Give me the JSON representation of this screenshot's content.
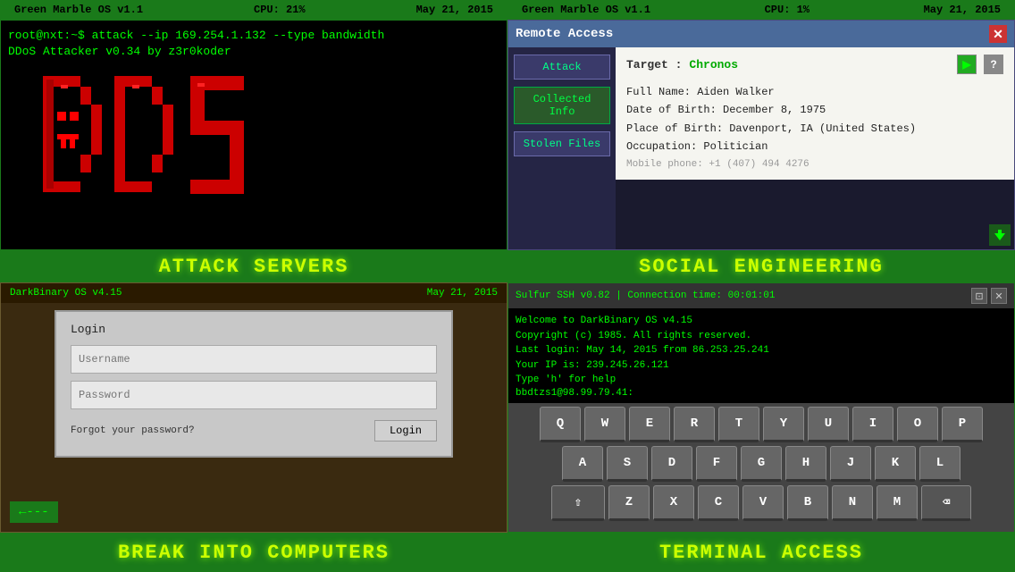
{
  "top_status_bar_left": {
    "os": "Green Marble OS v1.1",
    "cpu": "CPU: 21%",
    "date": "May 21, 2015"
  },
  "top_status_bar_right": {
    "os": "Green Marble OS v1.1",
    "cpu": "CPU: 1%",
    "date": "May 21, 2015"
  },
  "terminal": {
    "command": "root@nxt:~$ attack --ip 169.254.1.132 --type bandwidth",
    "subtitle": "DDoS Attacker v0.34 by z3r0koder"
  },
  "remote_access": {
    "title": "Remote Access",
    "target_label": "Target :",
    "target_value": "Chronos",
    "buttons": {
      "attack": "Attack",
      "collected_info": "Collected Info",
      "stolen_files": "Stolen Files"
    },
    "info": {
      "full_name": "Full Name: Aiden Walker",
      "dob": "Date of Birth: December 8, 1975",
      "pob": "Place of Birth: Davenport, IA (United States)",
      "occupation": "Occupation: Politician",
      "mobile": "Mobile phone: +1 (407) 494 4276"
    }
  },
  "section_labels": {
    "attack_servers": "ATTACK SERVERS",
    "social_engineering": "SOCIAL ENGINEERING",
    "break_into_computers": "BREAK INTO COMPUTERS",
    "terminal_access": "TERMINAL ACCESS"
  },
  "darkbinary_status": {
    "os": "DarkBinary OS v4.15",
    "date": "May 21, 2015"
  },
  "login_window": {
    "title": "Login",
    "username_placeholder": "Username",
    "password_placeholder": "Password",
    "forgot_text": "Forgot your password?",
    "login_btn": "Login"
  },
  "arrow_btn": {
    "text": "←---"
  },
  "ssh": {
    "title": "Sulfur SSH v0.82 | Connection time: 00:01:01",
    "lines": [
      "Welcome to DarkBinary OS v4.15",
      "Copyright (c) 1985. All rights reserved.",
      "Last login: May 14, 2015 from 86.253.25.241",
      "Your IP is: 239.245.26.121",
      "Type 'h' for help"
    ],
    "prompt": "bbdtzs1@98.99.79.41:"
  },
  "keyboard": {
    "row1": [
      "Q",
      "W",
      "E",
      "R",
      "T",
      "Y",
      "U",
      "I",
      "O",
      "P"
    ],
    "row2": [
      "A",
      "S",
      "D",
      "F",
      "G",
      "H",
      "J",
      "K",
      "L"
    ],
    "row3_special_left": "⇧",
    "row3": [
      "Z",
      "X",
      "C",
      "V",
      "B",
      "N",
      "M"
    ],
    "row3_special_right": "⌫"
  }
}
